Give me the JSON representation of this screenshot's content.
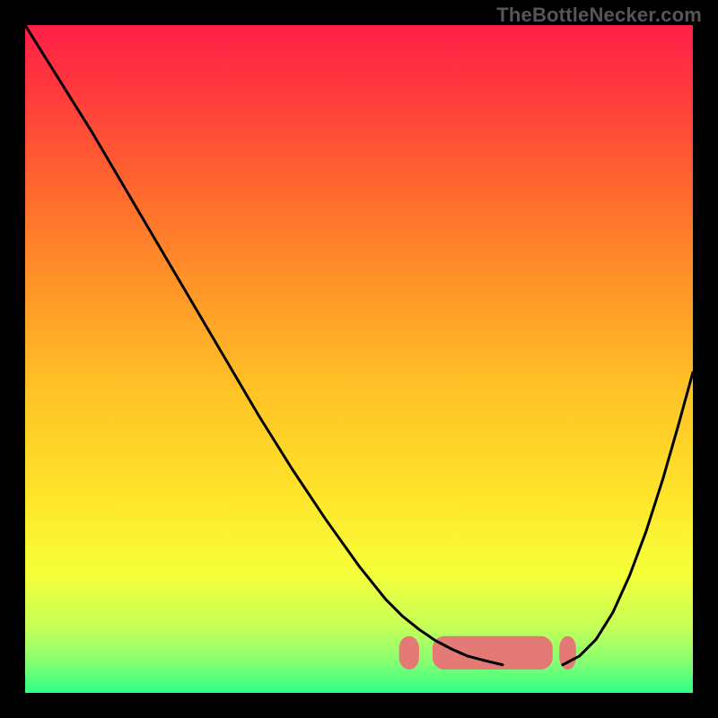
{
  "attribution": "TheBottleNecker.com",
  "gradient": {
    "stops": [
      {
        "offset": 0.0,
        "color": "#ff1f47"
      },
      {
        "offset": 0.1,
        "color": "#ff3a3d"
      },
      {
        "offset": 0.25,
        "color": "#ff6a2e"
      },
      {
        "offset": 0.4,
        "color": "#ff9828"
      },
      {
        "offset": 0.55,
        "color": "#ffc326"
      },
      {
        "offset": 0.7,
        "color": "#ffe32a"
      },
      {
        "offset": 0.82,
        "color": "#f6ff3a"
      },
      {
        "offset": 0.9,
        "color": "#c6ff57"
      },
      {
        "offset": 0.95,
        "color": "#8cff70"
      },
      {
        "offset": 1.0,
        "color": "#2fff86"
      }
    ]
  },
  "band": {
    "top_y": 0.915,
    "bottom_y": 0.965,
    "color": "#e37a76",
    "radius_frac": 0.018
  },
  "chart_data": {
    "type": "line",
    "title": "",
    "xlabel": "",
    "ylabel": "",
    "xlim": [
      0,
      1
    ],
    "ylim": [
      0,
      1
    ],
    "note": "x,y normalized to plot area; y=0 at top, y=1 at bottom (no visible axis ticks). Two curves drawn on a full-plot vertical gradient background.",
    "series": [
      {
        "name": "curve-left",
        "stroke": "#000000",
        "stroke_width": 3,
        "x": [
          0.0,
          0.05,
          0.1,
          0.15,
          0.2,
          0.25,
          0.3,
          0.35,
          0.4,
          0.45,
          0.5,
          0.54,
          0.565,
          0.59,
          0.615,
          0.64,
          0.663,
          0.69,
          0.715
        ],
        "y": [
          0.0,
          0.08,
          0.16,
          0.245,
          0.33,
          0.415,
          0.5,
          0.585,
          0.665,
          0.74,
          0.81,
          0.86,
          0.885,
          0.905,
          0.922,
          0.935,
          0.945,
          0.952,
          0.958
        ]
      },
      {
        "name": "curve-right",
        "stroke": "#000000",
        "stroke_width": 3,
        "x": [
          0.805,
          0.83,
          0.855,
          0.88,
          0.905,
          0.93,
          0.955,
          0.978,
          1.0
        ],
        "y": [
          0.958,
          0.945,
          0.92,
          0.88,
          0.825,
          0.758,
          0.68,
          0.6,
          0.52
        ]
      }
    ],
    "band_segments": [
      {
        "name": "left-cap",
        "x": [
          0.56,
          0.59
        ]
      },
      {
        "name": "middle",
        "x": [
          0.61,
          0.79
        ]
      },
      {
        "name": "right-cap",
        "x": [
          0.8,
          0.825
        ]
      }
    ]
  }
}
